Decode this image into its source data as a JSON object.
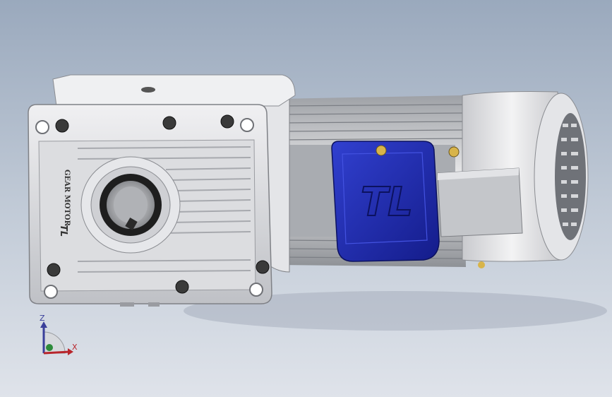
{
  "viewport": {
    "background_top": "#9aa9bd",
    "background_bottom": "#dfe3ea"
  },
  "model": {
    "gearbox_nameplate_text": "GEAR MOTOR",
    "gearbox_logo_text": "TL",
    "terminal_box_logo_text": "TL",
    "colors": {
      "housing": "#d9dadd",
      "terminal_box": "#1f2bb3",
      "bolt": "#3a3a3a"
    }
  },
  "triad": {
    "z_label": "Z",
    "x_label": "X",
    "z_color": "#3a3f9a",
    "x_color": "#b8262c",
    "y_color": "#2e8b3a"
  }
}
